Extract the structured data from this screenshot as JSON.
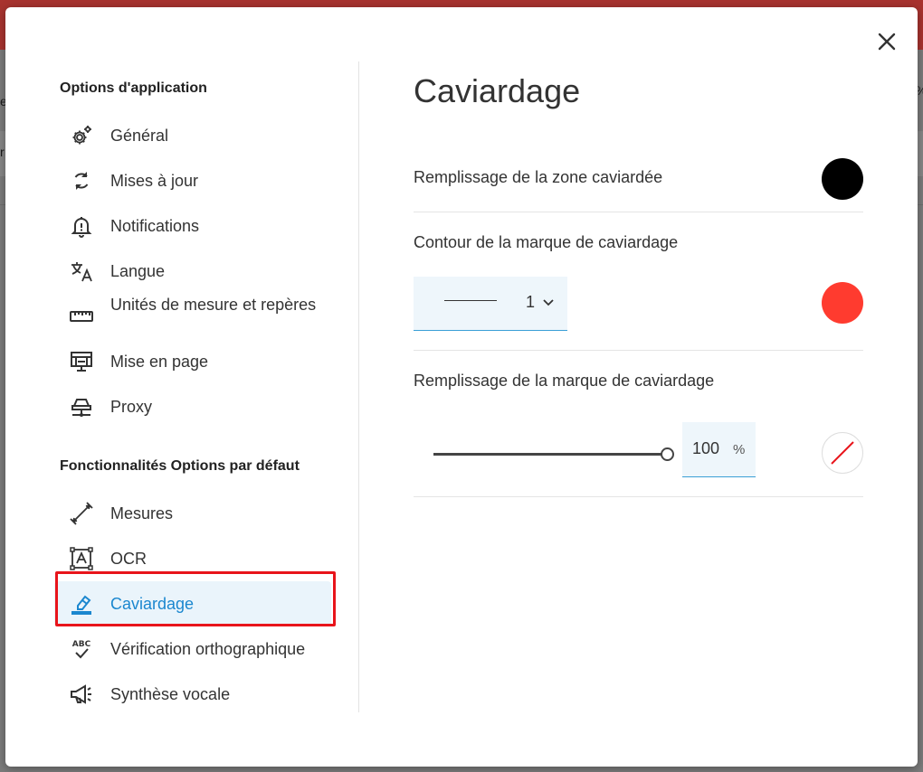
{
  "background": {
    "fragments": [
      "es",
      "r",
      "%"
    ]
  },
  "dialog": {
    "close_icon": "close-icon"
  },
  "sidebar": {
    "section_app": "Options d'application",
    "app_items": [
      {
        "label": "Général",
        "icon": "gear-icon"
      },
      {
        "label": "Mises à jour",
        "icon": "sync-icon"
      },
      {
        "label": "Notifications",
        "icon": "bell-icon"
      },
      {
        "label": "Langue",
        "icon": "translate-icon"
      },
      {
        "label": "Unités de mesure et repères",
        "icon": "ruler-icon"
      },
      {
        "label": "Mise en page",
        "icon": "layout-icon"
      },
      {
        "label": "Proxy",
        "icon": "network-icon"
      }
    ],
    "section_features": "Fonctionnalités Options par défaut",
    "feature_items": [
      {
        "label": "Mesures",
        "icon": "measure-icon"
      },
      {
        "label": "OCR",
        "icon": "ocr-icon"
      },
      {
        "label": "Caviardage",
        "icon": "redact-icon",
        "active": true
      },
      {
        "label": "Vérification orthographique",
        "icon": "spellcheck-icon"
      },
      {
        "label": "Synthèse vocale",
        "icon": "megaphone-icon"
      }
    ]
  },
  "main": {
    "title": "Caviardage",
    "fill_area": {
      "label": "Remplissage de la zone caviardée",
      "color": "#000000"
    },
    "outline": {
      "label": "Contour de la marque de caviardage",
      "stroke_width": "1",
      "color": "#ff3b2f"
    },
    "mark_fill": {
      "label": "Remplissage de la marque de caviardage",
      "opacity_value": "100",
      "opacity_unit": "%",
      "opacity_fraction": 1.0,
      "color": "none"
    }
  },
  "colors": {
    "accent": "#1b87cf",
    "active_bg": "#eaf4fb",
    "highlight": "#e8141b"
  }
}
